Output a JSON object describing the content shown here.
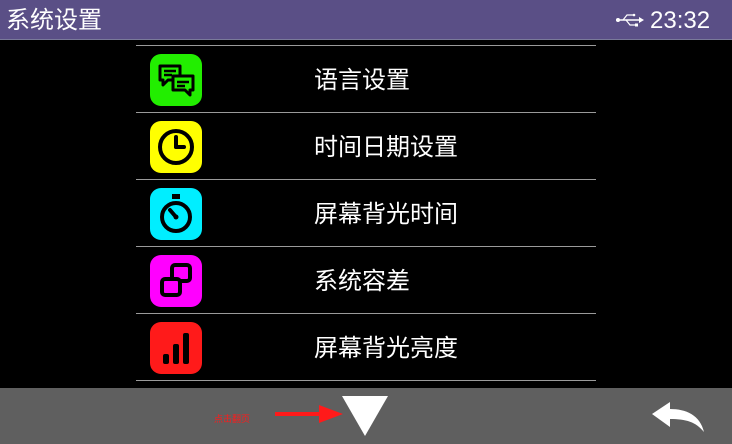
{
  "header": {
    "title": "系统设置",
    "time": "23:32",
    "usb_icon": "usb-icon"
  },
  "menu": {
    "items": [
      {
        "label": "语言设置",
        "icon": "chat-bubbles-icon",
        "color": "#22ee00"
      },
      {
        "label": "时间日期设置",
        "icon": "clock-icon",
        "color": "#ffff00"
      },
      {
        "label": "屏幕背光时间",
        "icon": "stopwatch-icon",
        "color": "#00eeff"
      },
      {
        "label": "系统容差",
        "icon": "tolerance-shapes-icon",
        "color": "#ff00ff"
      },
      {
        "label": "屏幕背光亮度",
        "icon": "brightness-bars-icon",
        "color": "#ff1a1a"
      }
    ]
  },
  "footer": {
    "hint": "点击翻页",
    "hint_color": "#ff1a1a",
    "page_down_icon": "triangle-down-icon",
    "back_icon": "back-arrow-icon"
  },
  "colors": {
    "header_bg": "#5a4f86",
    "footer_bg": "#5f5f5f",
    "background": "#000000"
  }
}
